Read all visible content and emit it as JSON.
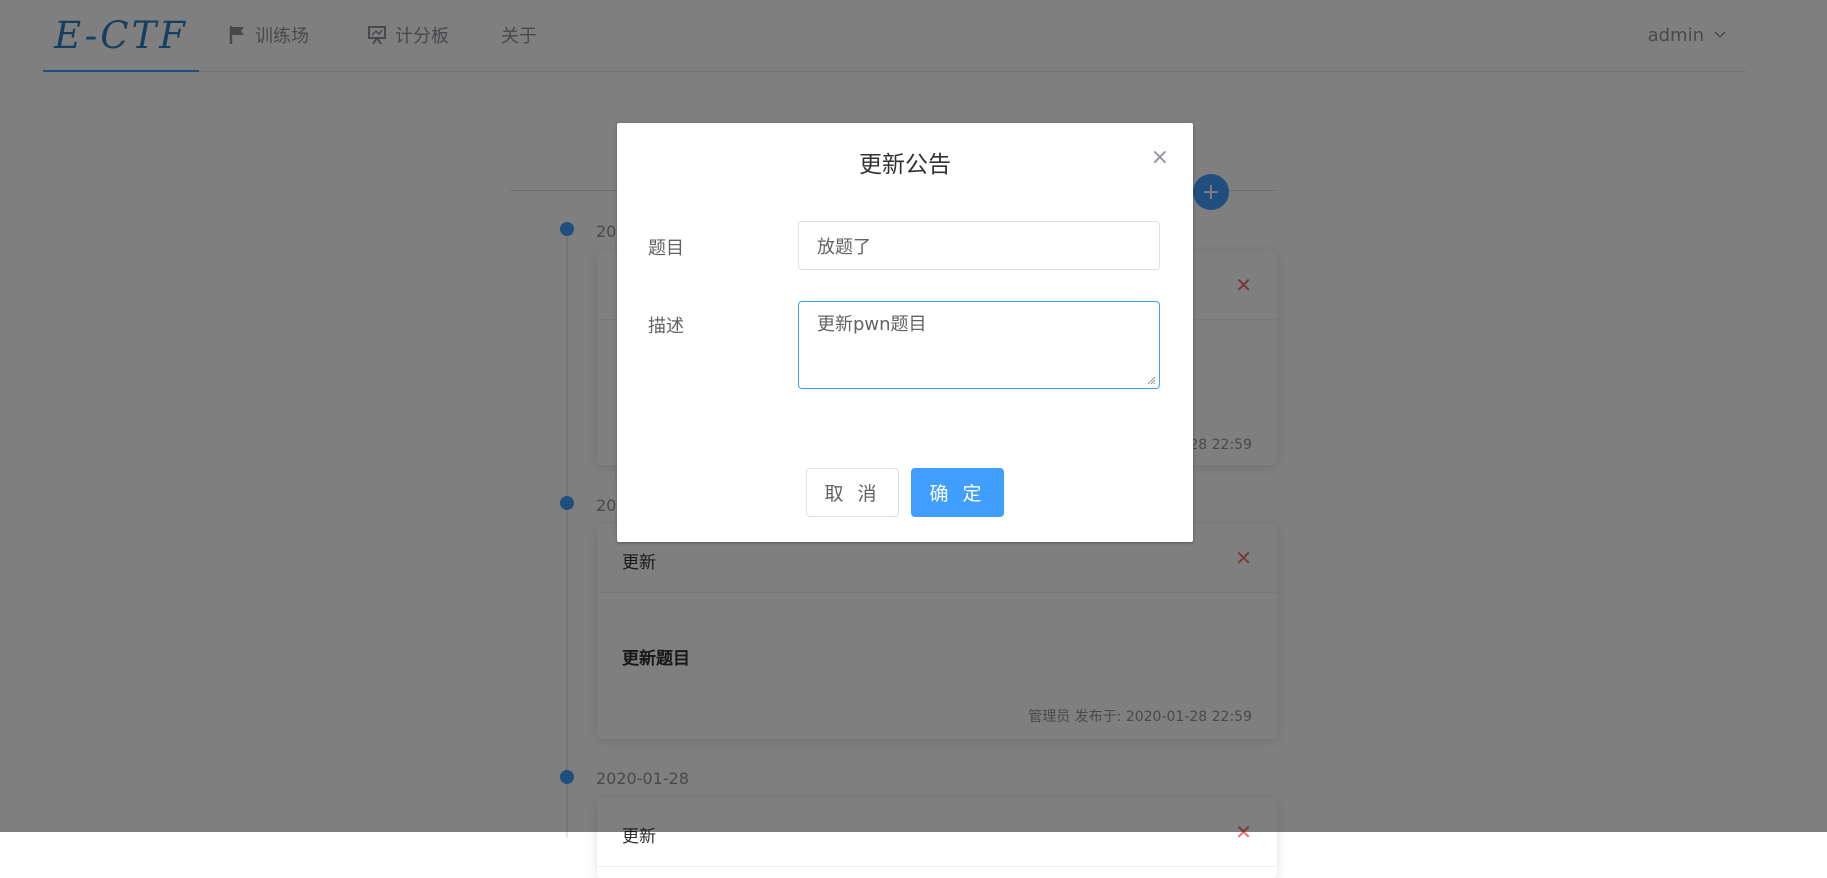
{
  "header": {
    "logo": "E-CTF",
    "nav": [
      "训练场",
      "计分板",
      "关于"
    ],
    "user": "admin"
  },
  "add_button": "+",
  "timeline": [
    {
      "date": "2020-01-28",
      "title": "",
      "description": "",
      "meta": "管理员 发布于: 2020-01-28 22:59"
    },
    {
      "date": "2020-01-28",
      "title": "更新",
      "description": "更新题目",
      "meta": "管理员 发布于: 2020-01-28 22:59"
    },
    {
      "date": "2020-01-28",
      "title": "更新",
      "description": "",
      "meta": ""
    }
  ],
  "dialog": {
    "title": "更新公告",
    "close": "×",
    "title_label": "题目",
    "title_value": "放题了",
    "desc_label": "描述",
    "desc_value": "更新pwn题目",
    "cancel": "取 消",
    "confirm": "确 定"
  },
  "colors": {
    "accent": "#409eff",
    "danger": "#f56c6c",
    "overlay": "rgba(0,0,0,0.5)"
  }
}
